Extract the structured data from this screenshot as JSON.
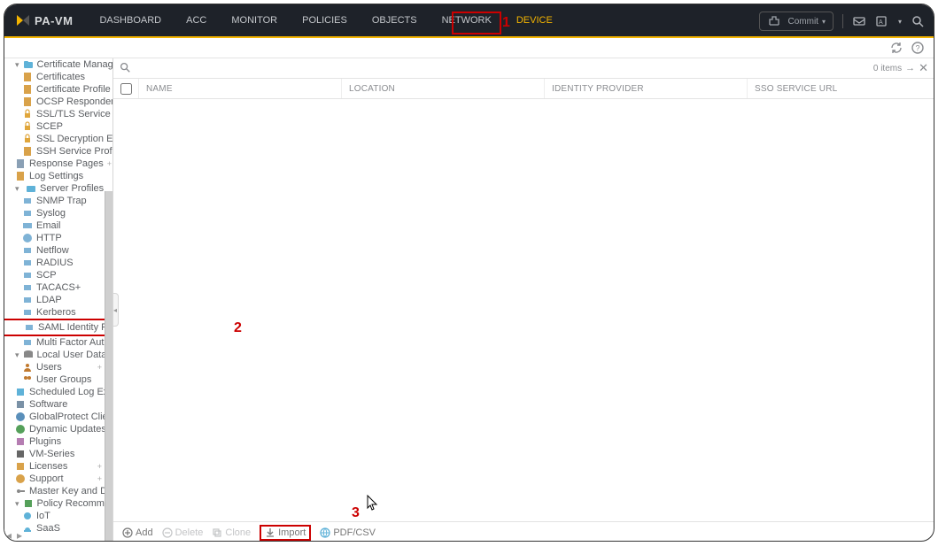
{
  "logo_text": "PA-VM",
  "nav": {
    "dashboard": "DASHBOARD",
    "acc": "ACC",
    "monitor": "MONITOR",
    "policies": "POLICIES",
    "objects": "OBJECTS",
    "network": "NETWORK",
    "device": "DEVICE"
  },
  "commit_label": "Commit",
  "callouts": {
    "one": "1",
    "two": "2",
    "three": "3"
  },
  "sidebar": {
    "cert_mgmt": "Certificate Management",
    "certificates": "Certificates",
    "cert_profile": "Certificate Profile",
    "ocsp": "OCSP Responder",
    "ssltls": "SSL/TLS Service Profile",
    "scep": "SCEP",
    "ssl_decrypt": "SSL Decryption Exclusio",
    "ssh_profile": "SSH Service Profile",
    "response_pages": "Response Pages",
    "log_settings": "Log Settings",
    "server_profiles": "Server Profiles",
    "snmp": "SNMP Trap",
    "syslog": "Syslog",
    "email": "Email",
    "http": "HTTP",
    "netflow": "Netflow",
    "radius": "RADIUS",
    "scp": "SCP",
    "tacacs": "TACACS+",
    "ldap": "LDAP",
    "kerberos": "Kerberos",
    "saml": "SAML Identity Provider",
    "mfa": "Multi Factor Authenticat",
    "local_user_db": "Local User Database",
    "users": "Users",
    "user_groups": "User Groups",
    "sched_log": "Scheduled Log Export",
    "software": "Software",
    "gp_client": "GlobalProtect Client",
    "dyn_updates": "Dynamic Updates",
    "plugins": "Plugins",
    "vm_series": "VM-Series",
    "licenses": "Licenses",
    "support": "Support",
    "master_key": "Master Key and Diagnostics",
    "policy_rec": "Policy Recommendation",
    "iot": "IoT",
    "saas": "SaaS"
  },
  "search": {
    "placeholder": "",
    "items_text": "0 items"
  },
  "columns": {
    "name": "NAME",
    "location": "LOCATION",
    "idp": "IDENTITY PROVIDER",
    "sso": "SSO SERVICE URL"
  },
  "footer": {
    "add": "Add",
    "delete": "Delete",
    "clone": "Clone",
    "import": "Import",
    "pdfcsv": "PDF/CSV"
  }
}
